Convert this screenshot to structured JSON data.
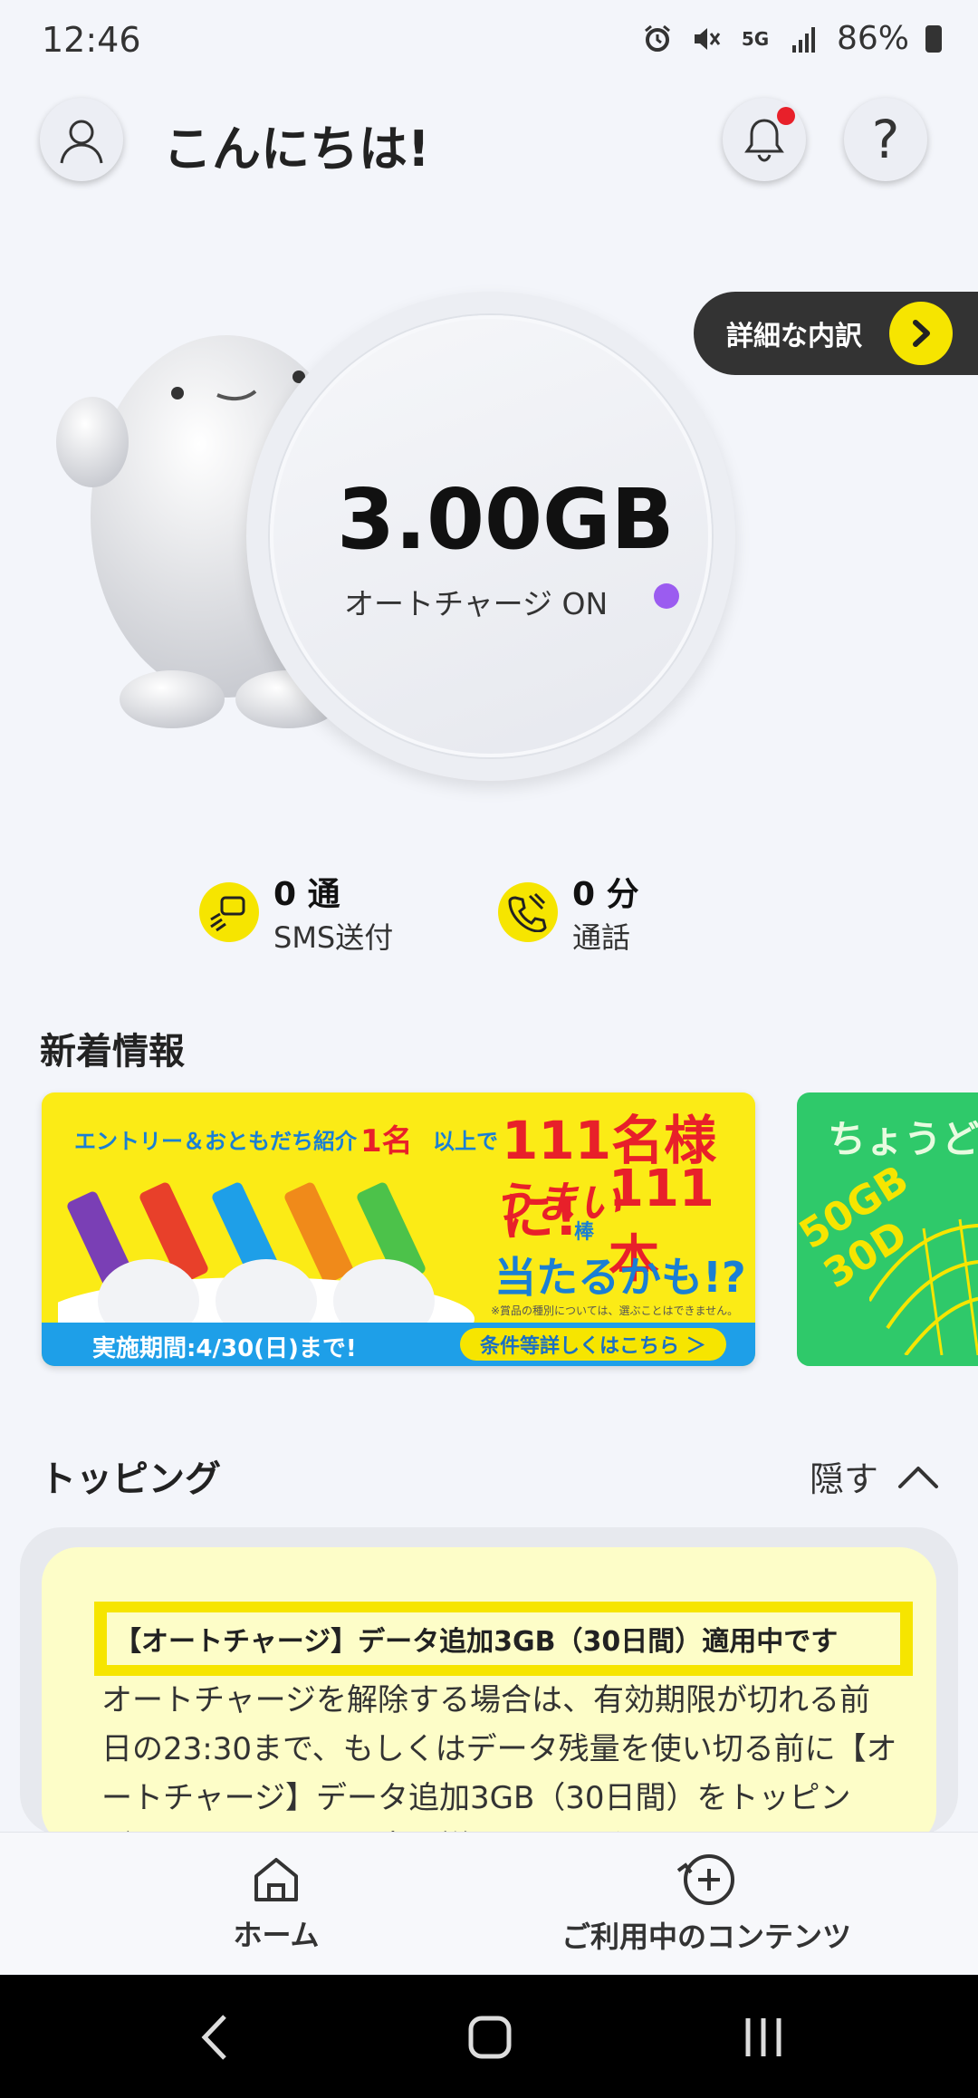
{
  "status_bar": {
    "time": "12:46",
    "network": "5G",
    "battery": "86%"
  },
  "header": {
    "greeting": "こんにちは!",
    "avatar_icon": "user-icon",
    "bell_icon": "bell-icon",
    "help_label": "?"
  },
  "data_meter": {
    "remaining": "3.00GB",
    "auto_charge": "オートチャージ ON",
    "detail_button": "詳細な内訳"
  },
  "usage": {
    "sms": {
      "value": "0 通",
      "label": "SMS送付"
    },
    "call": {
      "value": "0 分",
      "label": "通話"
    }
  },
  "news": {
    "title": "新着情報",
    "banner1": {
      "line1": "エントリー＆おともだち紹介",
      "line1_count": "1名",
      "line1_tail": "以上で",
      "headline": "111名様に!",
      "brand": "うまい",
      "brand_sub": "棒",
      "count": "111本",
      "chance": "当たるかも!?",
      "note": "※賞品の種別については、選ぶことはできません。",
      "period": "実施期間:4/30(日)まで!",
      "details": "条件等詳しくはこちら ＞"
    },
    "banner2": {
      "text": "ちょうど",
      "sub": "50GB 30D"
    }
  },
  "topping": {
    "title": "トッピング",
    "hide_label": "隠す",
    "highlight": "【オートチャージ】データ追加3GB（30日間）適用中です",
    "body": "オートチャージを解除する場合は、有効期限が切れる前日の23:30まで、もしくはデータ残量を使い切る前に【オートチャージ】データ追加3GB（30日間）をトッピング・オートチャージ中の詳しくアイガ"
  },
  "bottom_nav": {
    "home": "ホーム",
    "contents": "ご利用中のコンテンツ"
  },
  "colors": {
    "accent_yellow": "#f6e500",
    "purple": "#9b5cf0",
    "dark": "#333333"
  }
}
